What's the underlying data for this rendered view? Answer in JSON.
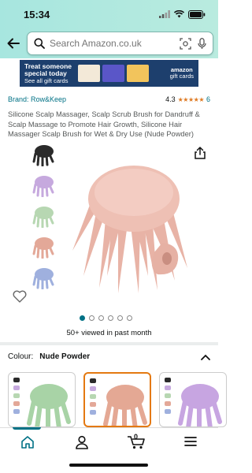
{
  "status": {
    "time": "15:34"
  },
  "search": {
    "placeholder": "Search Amazon.co.uk"
  },
  "promo": {
    "headline": "Treat someone special today",
    "sub": "See all gift cards",
    "brand_line1": "amazon",
    "brand_line2": "gift cards"
  },
  "product": {
    "brand": "Brand: Row&Keep",
    "rating": "4.3",
    "stars": "★★★★★",
    "review_count": "6",
    "title": "Silicone Scalp Massager, Scalp Scrub Brush for Dandruff & Scalp Massage to Promote Hair Growth, Silicone Hair Massager Scalp Brush for Wet & Dry Use (Nude Powder)",
    "viewed": "50+ viewed in past month"
  },
  "thumbnail_colors": [
    "#2a2a2a",
    "#c6a9de",
    "#b7d7b2",
    "#e3a898",
    "#9fb0de"
  ],
  "image_pager": {
    "count": 6,
    "active_index": 0
  },
  "colour": {
    "label": "Colour:",
    "value": "Nude Powder",
    "options": [
      {
        "name": "Green",
        "color": "#a8d3a6"
      },
      {
        "name": "Nude Powder",
        "color": "#e4a894"
      },
      {
        "name": "Purple",
        "color": "#c7a5e1"
      }
    ]
  },
  "cart": {
    "count": "0"
  },
  "colors": {
    "accent": "#007185",
    "star": "#de7921",
    "header_bg": "#a7e6df",
    "main_product": "#eec0b4"
  }
}
